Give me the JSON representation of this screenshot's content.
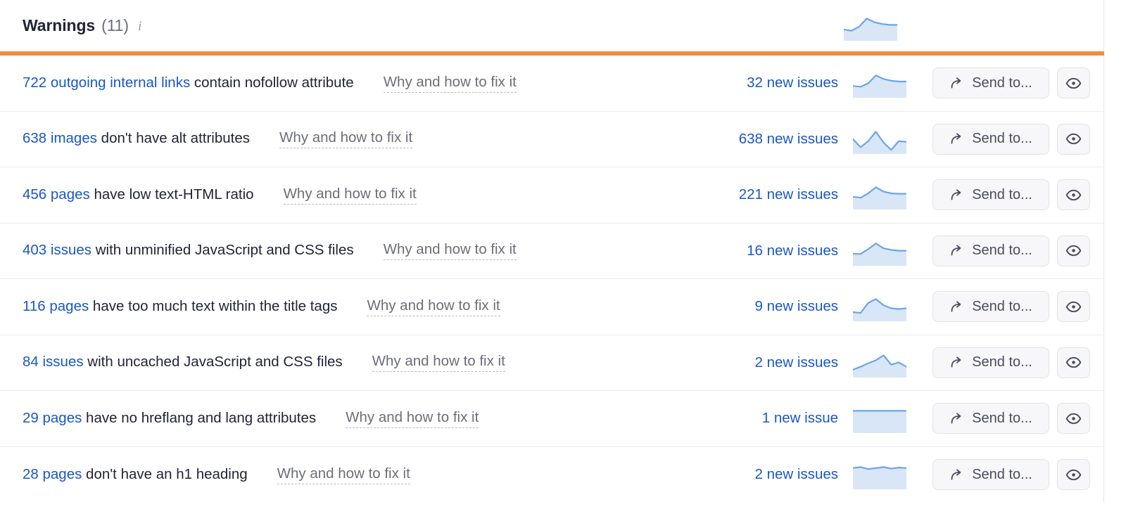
{
  "header": {
    "title": "Warnings",
    "count": "(11)",
    "info_icon": "info-icon",
    "sparkline": [
      22,
      19,
      28,
      46,
      38,
      34,
      32,
      32
    ],
    "accent_color": "#f28c42"
  },
  "colors": {
    "link": "#1a57c7",
    "text": "#222437",
    "muted": "#6c6e79",
    "accent": "#f28c42",
    "spark_line": "#6aa6e8",
    "spark_fill": "#d8e6f7",
    "button_bg": "#f7f7f9",
    "button_border": "#e3e3e8",
    "row_divider": "#ececed"
  },
  "buttons": {
    "send_to_label": "Send to...",
    "send_to_icon": "share-arrow-icon",
    "eye_icon": "eye-icon"
  },
  "why_link_label": "Why and how to fix it",
  "rows": [
    {
      "count_text": "722 outgoing internal links",
      "rest_text": " contain nofollow attribute",
      "why": "Why and how to fix it",
      "new_issues": "32 new issues",
      "sparkline": [
        24,
        22,
        30,
        48,
        40,
        36,
        34,
        34
      ]
    },
    {
      "count_text": "638 images",
      "rest_text": " don't have alt attributes",
      "why": "Why and how to fix it",
      "new_issues": "638 new issues",
      "sparkline": [
        40,
        16,
        34,
        62,
        30,
        8,
        34,
        32
      ]
    },
    {
      "count_text": "456 pages",
      "rest_text": " have low text-HTML ratio",
      "why": "Why and how to fix it",
      "new_issues": "221 new issues",
      "sparkline": [
        26,
        24,
        34,
        48,
        38,
        34,
        33,
        33
      ]
    },
    {
      "count_text": "403 issues",
      "rest_text": " with unminified JavaScript and CSS files",
      "why": "Why and how to fix it",
      "new_issues": "16 new issues",
      "sparkline": [
        26,
        26,
        38,
        52,
        40,
        36,
        34,
        34
      ]
    },
    {
      "count_text": "116 pages",
      "rest_text": " have too much text within the title tags",
      "why": "Why and how to fix it",
      "new_issues": "9 new issues",
      "sparkline": [
        20,
        18,
        44,
        54,
        38,
        30,
        28,
        30
      ]
    },
    {
      "count_text": "84 issues",
      "rest_text": " with uncached JavaScript and CSS files",
      "why": "Why and how to fix it",
      "new_issues": "2 new issues",
      "sparkline": [
        18,
        26,
        36,
        44,
        58,
        32,
        38,
        26
      ]
    },
    {
      "count_text": "29 pages",
      "rest_text": " have no hreflang and lang attributes",
      "why": "Why and how to fix it",
      "new_issues": "1 new issue",
      "sparkline": [
        40,
        40,
        40,
        40,
        40,
        40,
        40,
        40
      ]
    },
    {
      "count_text": "28 pages",
      "rest_text": " don't have an h1 heading",
      "why": "Why and how to fix it",
      "new_issues": "2 new issues",
      "sparkline": [
        38,
        40,
        36,
        38,
        40,
        37,
        39,
        38
      ]
    }
  ]
}
